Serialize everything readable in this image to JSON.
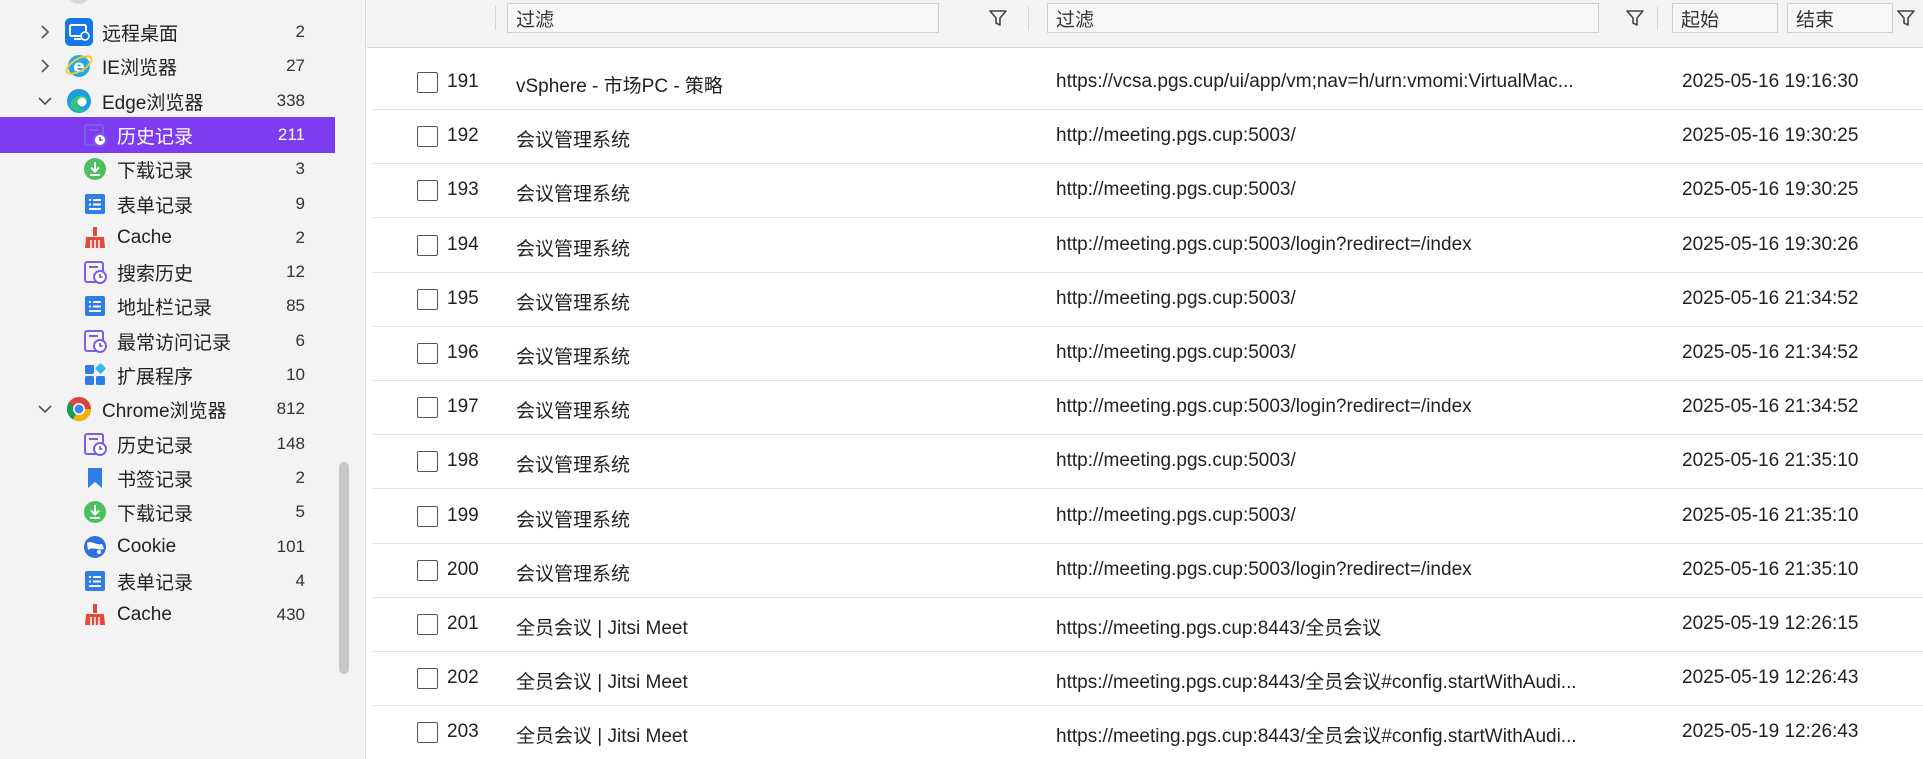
{
  "sidebar": {
    "items": [
      {
        "label": "远程桌面",
        "count": "2",
        "icon": "remote-desktop-icon",
        "level": "top",
        "expanded": false,
        "selected": false
      },
      {
        "label": "IE浏览器",
        "count": "27",
        "icon": "ie-browser-icon",
        "level": "top",
        "expanded": false,
        "selected": false
      },
      {
        "label": "Edge浏览器",
        "count": "338",
        "icon": "edge-browser-icon",
        "level": "top",
        "expanded": true,
        "selected": false
      },
      {
        "label": "历史记录",
        "count": "211",
        "icon": "history-icon",
        "level": "child",
        "selected": true
      },
      {
        "label": "下载记录",
        "count": "3",
        "icon": "download-icon",
        "level": "child",
        "selected": false
      },
      {
        "label": "表单记录",
        "count": "9",
        "icon": "form-icon",
        "level": "child",
        "selected": false
      },
      {
        "label": "Cache",
        "count": "2",
        "icon": "cache-broom-icon",
        "level": "child",
        "selected": false
      },
      {
        "label": "搜索历史",
        "count": "12",
        "icon": "search-history-icon",
        "level": "child",
        "selected": false
      },
      {
        "label": "地址栏记录",
        "count": "85",
        "icon": "address-bar-icon",
        "level": "child",
        "selected": false
      },
      {
        "label": "最常访问记录",
        "count": "6",
        "icon": "frequent-visits-icon",
        "level": "child",
        "selected": false
      },
      {
        "label": "扩展程序",
        "count": "10",
        "icon": "extensions-icon",
        "level": "child",
        "selected": false
      },
      {
        "label": "Chrome浏览器",
        "count": "812",
        "icon": "chrome-browser-icon",
        "level": "top",
        "expanded": true,
        "selected": false
      },
      {
        "label": "历史记录",
        "count": "148",
        "icon": "history-icon",
        "level": "child",
        "selected": false
      },
      {
        "label": "书签记录",
        "count": "2",
        "icon": "bookmark-icon",
        "level": "child",
        "selected": false
      },
      {
        "label": "下载记录",
        "count": "5",
        "icon": "download-icon",
        "level": "child",
        "selected": false
      },
      {
        "label": "Cookie",
        "count": "101",
        "icon": "cookie-icon",
        "level": "child",
        "selected": false
      },
      {
        "label": "表单记录",
        "count": "4",
        "icon": "form-icon",
        "level": "child",
        "selected": false
      },
      {
        "label": "Cache",
        "count": "430",
        "icon": "cache-broom-icon",
        "level": "child",
        "selected": false
      }
    ],
    "selected_color": "#7d3cf0"
  },
  "filters": {
    "title_placeholder": "过滤",
    "url_placeholder": "过滤",
    "start_placeholder": "起始",
    "end_placeholder": "结束"
  },
  "table": {
    "rows": [
      {
        "num": "191",
        "title": "vSphere - 市场PC - 策略",
        "url": "https://vcsa.pgs.cup/ui/app/vm;nav=h/urn:vmomi:VirtualMac...",
        "time": "2025-05-16 19:16:30"
      },
      {
        "num": "192",
        "title": "会议管理系统",
        "url": "http://meeting.pgs.cup:5003/",
        "time": "2025-05-16 19:30:25"
      },
      {
        "num": "193",
        "title": "会议管理系统",
        "url": "http://meeting.pgs.cup:5003/",
        "time": "2025-05-16 19:30:25"
      },
      {
        "num": "194",
        "title": "会议管理系统",
        "url": "http://meeting.pgs.cup:5003/login?redirect=/index",
        "time": "2025-05-16 19:30:26"
      },
      {
        "num": "195",
        "title": "会议管理系统",
        "url": "http://meeting.pgs.cup:5003/",
        "time": "2025-05-16 21:34:52"
      },
      {
        "num": "196",
        "title": "会议管理系统",
        "url": "http://meeting.pgs.cup:5003/",
        "time": "2025-05-16 21:34:52"
      },
      {
        "num": "197",
        "title": "会议管理系统",
        "url": "http://meeting.pgs.cup:5003/login?redirect=/index",
        "time": "2025-05-16 21:34:52"
      },
      {
        "num": "198",
        "title": "会议管理系统",
        "url": "http://meeting.pgs.cup:5003/",
        "time": "2025-05-16 21:35:10"
      },
      {
        "num": "199",
        "title": "会议管理系统",
        "url": "http://meeting.pgs.cup:5003/",
        "time": "2025-05-16 21:35:10"
      },
      {
        "num": "200",
        "title": "会议管理系统",
        "url": "http://meeting.pgs.cup:5003/login?redirect=/index",
        "time": "2025-05-16 21:35:10"
      },
      {
        "num": "201",
        "title": "全员会议 | Jitsi Meet",
        "url": "https://meeting.pgs.cup:8443/全员会议",
        "time": "2025-05-19 12:26:15"
      },
      {
        "num": "202",
        "title": "全员会议 | Jitsi Meet",
        "url": "https://meeting.pgs.cup:8443/全员会议#config.startWithAudi...",
        "time": "2025-05-19 12:26:43"
      },
      {
        "num": "203",
        "title": "全员会议 | Jitsi Meet",
        "url": "https://meeting.pgs.cup:8443/全员会议#config.startWithAudi...",
        "time": "2025-05-19 12:26:43"
      }
    ]
  }
}
